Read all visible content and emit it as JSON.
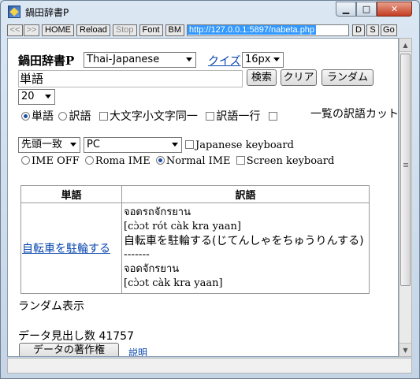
{
  "window": {
    "title": "鍋田辞書P",
    "min_label": "▁",
    "max_label": "□",
    "close_label": "✕"
  },
  "toolbar": {
    "back_label": "<<",
    "forward_label": ">>",
    "home_label": "HOME",
    "reload_label": "Reload",
    "stop_label": "Stop",
    "font_label": "Font",
    "bm_label": "BM",
    "url": "http://127.0.0.1:5897/nabeta.php",
    "d_label": "D",
    "s_label": "S",
    "go_label": "Go"
  },
  "app": {
    "title": "鍋田辞書P",
    "dict_select": "Thai-Japanese",
    "quiz_link": "クイズ",
    "font_size_select": "16px",
    "search_input_value": "単語",
    "search_button": "検索",
    "clear_button": "クリア",
    "random_button": "ランダム",
    "count_select": "20"
  },
  "options": {
    "radio_word": "単語",
    "radio_translation": "訳語",
    "check_case": "大文字小文字同一",
    "check_oneline": "訳語一行",
    "check_cut": "一覧の訳語カット",
    "match_select": "先頭一致",
    "device_select": "PC",
    "check_japanese_keyboard": "Japanese keyboard",
    "ime_off": "IME OFF",
    "roma_ime": "Roma IME",
    "normal_ime": "Normal IME",
    "screen_keyboard": "Screen keyboard"
  },
  "table": {
    "headers": [
      "単語",
      "訳語"
    ],
    "row": {
      "word": "自転車を駐輪する",
      "lines": [
        "จอดรถจักรยาน",
        "[cɔ̀ɔt rót càk kra yaan]",
        "自転車を駐輪する(じてんしゃをちゅうりんする)",
        "-------",
        "จอดจักรยาน",
        "[cɔ̀ɔt càk kra yaan]"
      ]
    }
  },
  "footer": {
    "random_display": "ランダム表示",
    "entry_count": "データ見出し数 41757",
    "copyright_button": "データの著作権",
    "help_link": "説明"
  },
  "colors": {
    "link": "#0645ad",
    "radio_dot": "#1d4fa8",
    "url_highlight": "#3399ff"
  },
  "icons": [
    "app-icon",
    "chevron-down-icon",
    "scroll-up-icon",
    "scroll-down-icon"
  ]
}
